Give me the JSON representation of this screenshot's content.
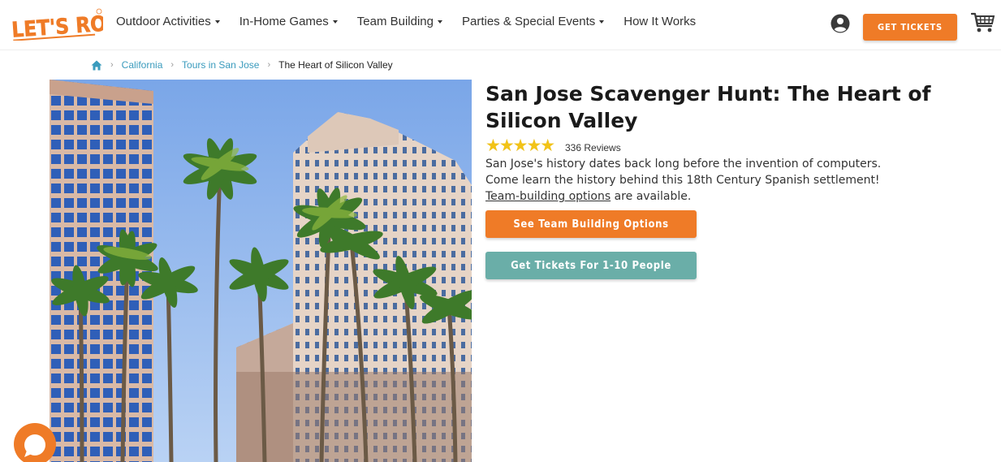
{
  "brand": {
    "logo_text": "LET'S ROAM",
    "accent": "#ef7b27",
    "teal": "#6aaea8",
    "link": "#3a9bbd"
  },
  "nav": {
    "items": [
      {
        "label": "Outdoor Activities",
        "has_caret": true
      },
      {
        "label": "In-Home Games",
        "has_caret": true
      },
      {
        "label": "Team Building",
        "has_caret": true
      },
      {
        "label": "Parties & Special Events",
        "has_caret": true
      },
      {
        "label": "How It Works",
        "has_caret": false
      }
    ],
    "get_tickets_label": "GET TICKETS",
    "account_icon": "user-circle-icon",
    "cart_icon": "shopping-cart-icon"
  },
  "breadcrumb": {
    "home_icon": "home-icon",
    "items": [
      {
        "label": "California",
        "link": true
      },
      {
        "label": "Tours in San Jose",
        "link": true
      },
      {
        "label": "The Heart of Silicon Valley",
        "link": false
      }
    ]
  },
  "product": {
    "title": "San Jose Scavenger Hunt: The Heart of Silicon Valley",
    "rating": 4.5,
    "rating_max": 5,
    "reviews_label": "336 Reviews",
    "description_line1": "San Jose's history dates back long before the invention of computers.",
    "description_line2": "Come learn the history behind this 18th Century Spanish settlement!",
    "team_link_text": "Team-building options",
    "team_link_suffix": " are available.",
    "btn_team_label": "See Team Building Options",
    "btn_tickets_label": "Get Tickets For 1-10 People"
  },
  "chat": {
    "icon": "chat-bubble-icon"
  }
}
